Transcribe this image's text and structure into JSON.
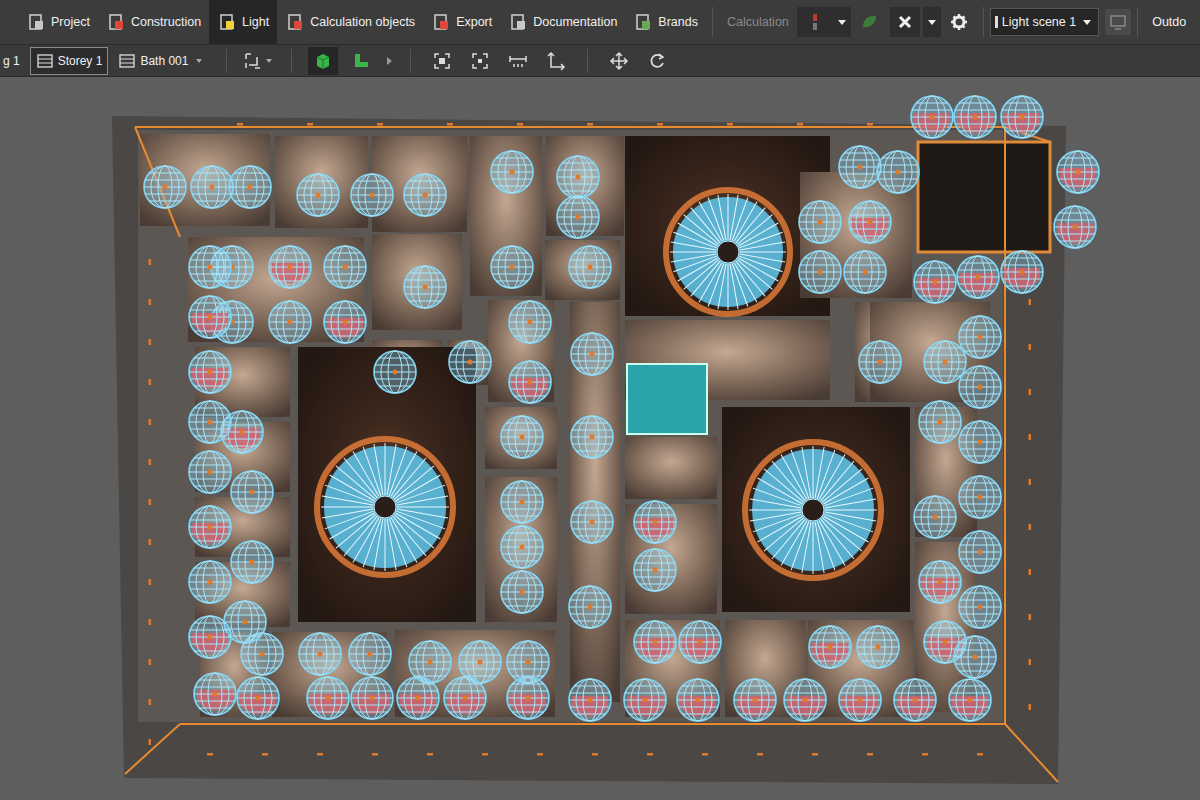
{
  "toolbar": {
    "tabs": [
      {
        "label": "Project",
        "selected": false
      },
      {
        "label": "Construction",
        "selected": false
      },
      {
        "label": "Light",
        "selected": true
      },
      {
        "label": "Calculation objects",
        "selected": false
      },
      {
        "label": "Export",
        "selected": false
      },
      {
        "label": "Documentation",
        "selected": false
      },
      {
        "label": "Brands",
        "selected": false
      }
    ],
    "calculation": {
      "label": "Calculation",
      "disabled": true
    },
    "light_scene": {
      "value": "Light scene 1"
    },
    "overflow_tab": "Outdo"
  },
  "subbar": {
    "breadcrumbs": [
      {
        "label": "g 1",
        "selected": false
      },
      {
        "label": "Storey 1",
        "selected": true
      },
      {
        "label": "Bath 001",
        "selected": false
      }
    ],
    "view_modes": [
      {
        "kind": "3d",
        "selected": true
      },
      {
        "kind": "plan",
        "selected": false
      }
    ]
  }
}
